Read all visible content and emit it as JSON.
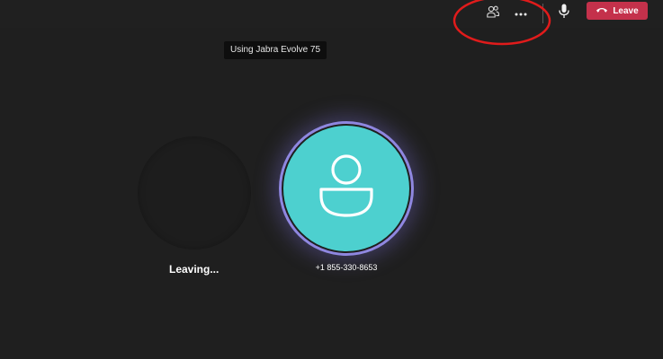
{
  "window": {
    "background": "#1f1f1f",
    "topbar_background": "#202020"
  },
  "toolbar": {
    "people_icon": "people-icon",
    "more_icon": "more-options-icon",
    "mic_icon": "microphone-icon",
    "leave_icon": "hang-up-icon",
    "leave_label": "Leave",
    "leave_color": "#c4314b"
  },
  "annotation": {
    "shape": "ellipse",
    "color": "#e01b1b"
  },
  "tooltip": {
    "text": "Using Jabra Evolve 75"
  },
  "local_participant": {
    "status": "Leaving..."
  },
  "remote_participant": {
    "avatar_icon": "person-icon",
    "avatar_color": "#4dd0cf",
    "ring_color": "#8f87e0",
    "name": "+1 855-330-8653"
  }
}
